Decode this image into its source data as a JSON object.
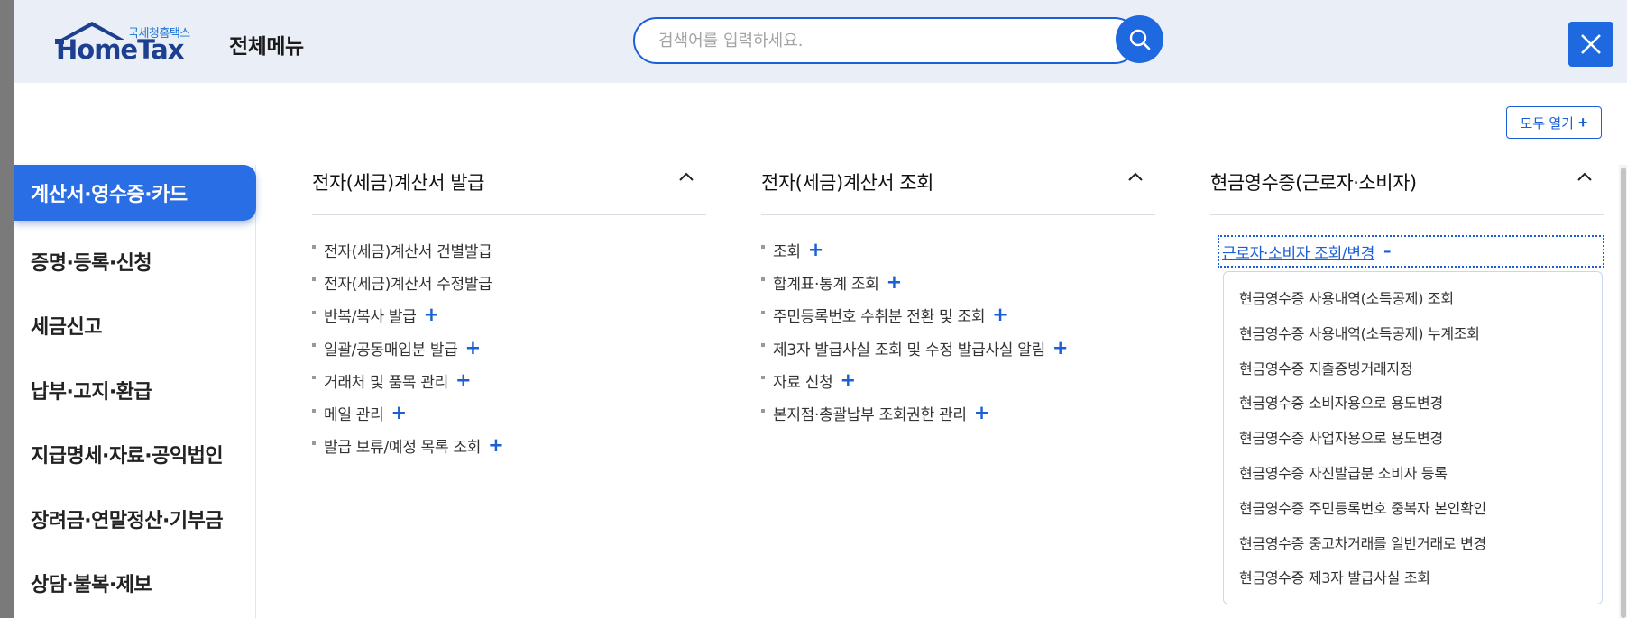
{
  "header": {
    "logo_small": "국세청홈택스",
    "logo_text": "HomeTax",
    "title": "전체메뉴",
    "search_placeholder": "검색어를 입력하세요.",
    "open_all_label": "모두 열기",
    "open_all_icon": "plus"
  },
  "sidebar": {
    "items": [
      {
        "label": "계산서·영수증·카드",
        "active": true
      },
      {
        "label": "증명·등록·신청",
        "active": false
      },
      {
        "label": "세금신고",
        "active": false
      },
      {
        "label": "납부·고지·환급",
        "active": false
      },
      {
        "label": "지급명세·자료·공익법인",
        "active": false
      },
      {
        "label": "장려금·연말정산·기부금",
        "active": false
      },
      {
        "label": "상담·불복·제보",
        "active": false
      }
    ]
  },
  "columns": [
    {
      "title": "전자(세금)계산서 발급",
      "items": [
        {
          "label": "전자(세금)계산서 건별발급",
          "plus": false
        },
        {
          "label": "전자(세금)계산서 수정발급",
          "plus": false
        },
        {
          "label": "반복/복사 발급",
          "plus": true
        },
        {
          "label": "일괄/공동매입분 발급",
          "plus": true
        },
        {
          "label": "거래처 및 품목 관리",
          "plus": true
        },
        {
          "label": "메일 관리",
          "plus": true
        },
        {
          "label": "발급 보류/예정 목록 조회",
          "plus": true
        }
      ]
    },
    {
      "title": "전자(세금)계산서 조회",
      "items": [
        {
          "label": "조회",
          "plus": true
        },
        {
          "label": "합계표·통계 조회",
          "plus": true
        },
        {
          "label": "주민등록번호 수취분 전환 및 조회",
          "plus": true
        },
        {
          "label": "제3자 발급사실 조회 및 수정 발급사실 알림",
          "plus": true
        },
        {
          "label": "자료 신청",
          "plus": true
        },
        {
          "label": "본지점·총괄납부 조회권한 관리",
          "plus": true
        }
      ]
    },
    {
      "title": "현금영수증(근로자·소비자)",
      "expanded_label": "근로자·소비자 조회/변경",
      "expanded_icon": "–",
      "sub_items": [
        "현금영수증 사용내역(소득공제) 조회",
        "현금영수증 사용내역(소득공제) 누계조회",
        "현금영수증 지출증빙거래지정",
        "현금영수증 소비자용으로 용도변경",
        "현금영수증 사업자용으로 용도변경",
        "현금영수증 자진발급분 소비자 등록",
        "현금영수증 주민등록번호 중복자 본인확인",
        "현금영수증 중고차거래를 일반거래로 변경",
        "현금영수증 제3자 발급사실 조회"
      ]
    }
  ],
  "colors": {
    "accent": "#1e68e0",
    "header_bg": "#e9eef7",
    "active_tab": "#2a6ee6"
  }
}
